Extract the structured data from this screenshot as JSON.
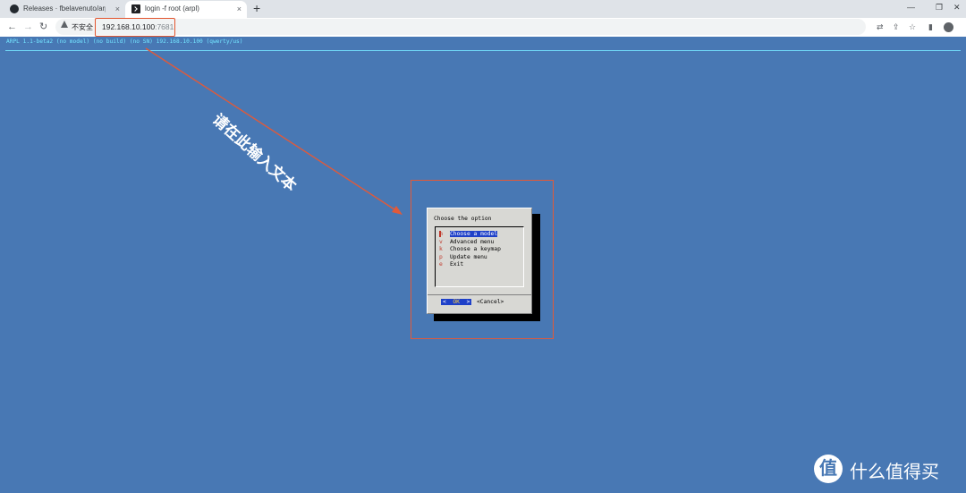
{
  "tabs": [
    {
      "title": "Releases · fbelavenuto/arpl",
      "close": "×"
    },
    {
      "title": "login -f root (arpl)",
      "close": "×"
    }
  ],
  "new_tab": "+",
  "window_controls": {
    "minimize": "—",
    "maximize": "❐",
    "close": "✕"
  },
  "nav": {
    "back": "←",
    "forward": "→",
    "reload": "↻"
  },
  "address": {
    "security": "不安全",
    "host": "192.168.10.100",
    "port": ":7681"
  },
  "toolbar_icons": {
    "translate": "⇄",
    "share": "⇪",
    "star": "☆",
    "panel": "▮"
  },
  "terminal": {
    "header": "ARPL 1.1-beta2 (no model) (no build) (no SN) 192.168.10.100 (qwerty/us)"
  },
  "annotation": {
    "text": "请在此输入文本",
    "color": "#e05a3a"
  },
  "dialog": {
    "title": "Choose the option",
    "items": [
      {
        "key": "m",
        "label": "Choose a model",
        "selected": true
      },
      {
        "key": "v",
        "label": "Advanced menu",
        "selected": false
      },
      {
        "key": "k",
        "label": "Choose a keymap",
        "selected": false
      },
      {
        "key": "p",
        "label": "Update menu",
        "selected": false
      },
      {
        "key": "e",
        "label": "Exit",
        "selected": false
      }
    ],
    "ok_left": "<",
    "ok_label": "OK",
    "ok_right": ">",
    "cancel_label": "<Cancel>"
  },
  "watermark": {
    "logo": "值",
    "text": "什么值得买"
  },
  "colors": {
    "terminal_bg": "#4878b4",
    "header_text": "#73e4ff",
    "highlight": "#1e40c8"
  }
}
